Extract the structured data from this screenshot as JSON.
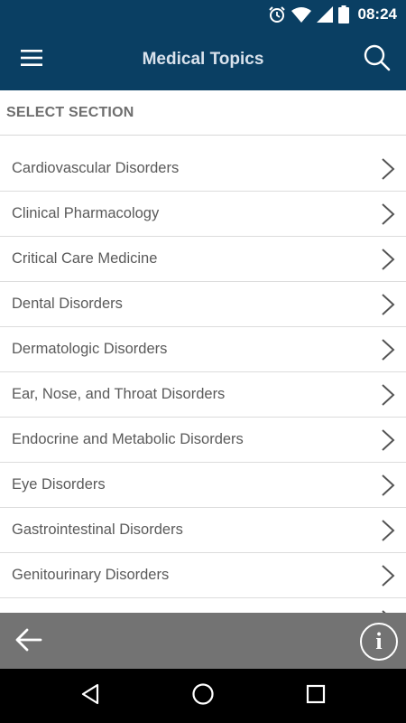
{
  "status_bar": {
    "time": "08:24",
    "icons": [
      "alarm-icon",
      "wifi-icon",
      "cellular-signal-icon",
      "battery-icon"
    ]
  },
  "app_bar": {
    "title": "Medical Topics",
    "menu_icon": "hamburger-menu-icon",
    "search_icon": "search-icon"
  },
  "section_header": "SELECT SECTION",
  "topics": [
    "Cardiovascular Disorders",
    "Clinical Pharmacology",
    "Critical Care Medicine",
    "Dental Disorders",
    "Dermatologic Disorders",
    "Ear, Nose, and Throat Disorders",
    "Endocrine and Metabolic Disorders",
    "Eye Disorders",
    "Gastrointestinal Disorders",
    "Genitourinary Disorders"
  ],
  "bottom_bar": {
    "back_icon": "back-arrow-icon",
    "info_label": "i"
  },
  "nav_bar": {
    "icons": [
      "nav-back-icon",
      "nav-home-icon",
      "nav-recents-icon"
    ]
  },
  "colors": {
    "header_bg": "#0a3f63",
    "bottom_bar_bg": "#737373",
    "nav_bar_bg": "#000000",
    "text": "#5a5a5a"
  }
}
